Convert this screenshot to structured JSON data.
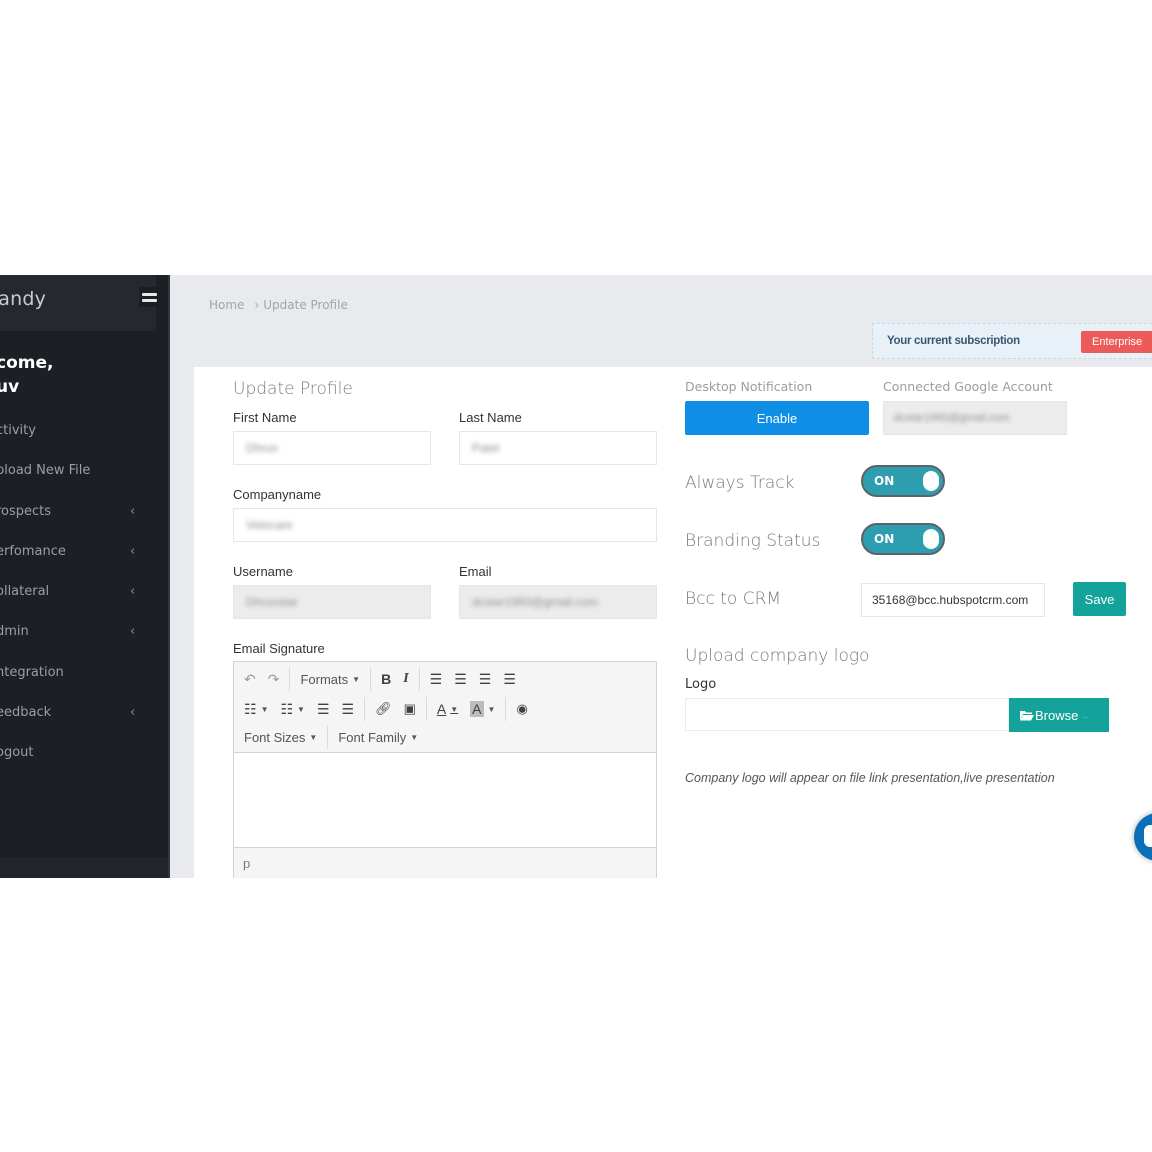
{
  "sidebar": {
    "brand": "nandy",
    "welcome_line1": "come,",
    "welcome_line2": "uv",
    "items": [
      {
        "label": "ctivity",
        "has_submenu": false
      },
      {
        "label": "pload New File",
        "has_submenu": false
      },
      {
        "label": "rospects",
        "has_submenu": true
      },
      {
        "label": "erfomance",
        "has_submenu": true
      },
      {
        "label": "ollateral",
        "has_submenu": true
      },
      {
        "label": "dmin",
        "has_submenu": true
      },
      {
        "label": "ntegration",
        "has_submenu": false
      },
      {
        "label": "eedback",
        "has_submenu": true
      },
      {
        "label": "ogout",
        "has_submenu": false
      }
    ],
    "chevron_glyph": "‹"
  },
  "breadcrumb": {
    "home": "Home",
    "separator": "›",
    "current": "Update Profile"
  },
  "subscription": {
    "label": "Your current subscription",
    "plan": "Enterprise"
  },
  "profile_form": {
    "title": "Update Profile",
    "first_name": {
      "label": "First Name",
      "value": "Dhruv"
    },
    "last_name": {
      "label": "Last Name",
      "value": "Patel"
    },
    "company_name": {
      "label": "Companyname",
      "value": "Velocare"
    },
    "username": {
      "label": "Username",
      "value": "Dhruvstar"
    },
    "email": {
      "label": "Email",
      "value": "dcstar1993@gmail.com"
    },
    "email_signature": {
      "label": "Email Signature",
      "toolbar": {
        "formats": "Formats",
        "bold": "B",
        "italic": "I",
        "font_sizes": "Font Sizes",
        "font_family": "Font Family",
        "text_color": "A",
        "bg_color": "A"
      },
      "status_path": "p"
    }
  },
  "settings": {
    "desktop_notification": {
      "label": "Desktop Notification",
      "button": "Enable"
    },
    "google_account": {
      "label": "Connected Google Account",
      "value": "dcstar1993@gmail.com"
    },
    "always_track": {
      "label": "Always Track",
      "state": "ON"
    },
    "branding_status": {
      "label": "Branding Status",
      "state": "ON"
    },
    "bcc_crm": {
      "label": "Bcc to CRM",
      "value": "35168@bcc.hubspotcrm.com",
      "save": "Save"
    },
    "upload_logo": {
      "title": "Upload company logo",
      "label": "Logo",
      "browse": "Browse",
      "browse_suffix": "...",
      "hint": "Company logo will appear on file link presentation,live presentation"
    }
  },
  "colors": {
    "sidebar_bg": "#1d1f27",
    "primary_blue": "#0e8ee4",
    "teal": "#14a39a",
    "toggle_on": "#2d9eb0",
    "badge_red": "#ec5a5a",
    "chat_blue": "#0b6fb7"
  }
}
